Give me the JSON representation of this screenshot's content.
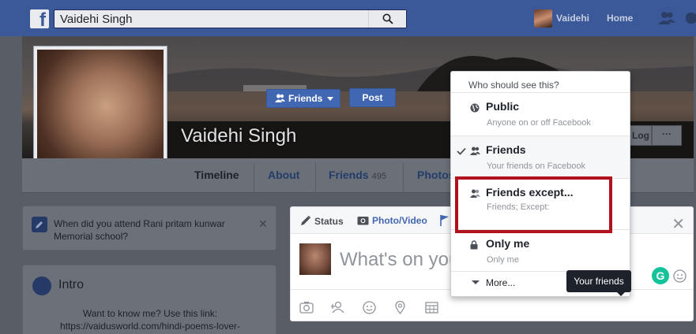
{
  "topbar": {
    "logo": "f",
    "search_value": "Vaidehi Singh",
    "user_name": "Vaidehi",
    "home_label": "Home"
  },
  "profile": {
    "name": "Vaidehi Singh",
    "tabs": {
      "timeline": "Timeline",
      "about": "About",
      "friends": "Friends",
      "friends_count": "495",
      "photos": "Photos"
    },
    "cover_button_log": "Log",
    "cover_button_more": "···"
  },
  "question": {
    "text": "When did you attend Rani pritam kunwar Memorial school?"
  },
  "intro": {
    "title": "Intro",
    "text_line1": "Want to know me? Use this link:",
    "text_line2": "https://vaidusworld.com/hindi-poems-lover-"
  },
  "composer": {
    "tab_status": "Status",
    "tab_photo": "Photo/Video",
    "placeholder": "What's on your mind?",
    "audience_button": "Friends",
    "post_button": "Post",
    "grammarly_letter": "G"
  },
  "privacy_menu": {
    "header": "Who should see this?",
    "items": [
      {
        "title": "Public",
        "subtitle": "Anyone on or off Facebook",
        "icon": "globe-icon"
      },
      {
        "title": "Friends",
        "subtitle": "Your friends on Facebook",
        "icon": "friends-icon",
        "selected": true
      },
      {
        "title": "Friends except...",
        "subtitle": "Friends; Except:",
        "icon": "friends-icon"
      },
      {
        "title": "Only me",
        "subtitle": "Only me",
        "icon": "lock-icon"
      }
    ],
    "more_label": "More..."
  },
  "tooltip": "Your friends",
  "colors": {
    "brand": "#3b5998",
    "button_blue": "#4267b2",
    "highlight_red": "#b0131d"
  }
}
